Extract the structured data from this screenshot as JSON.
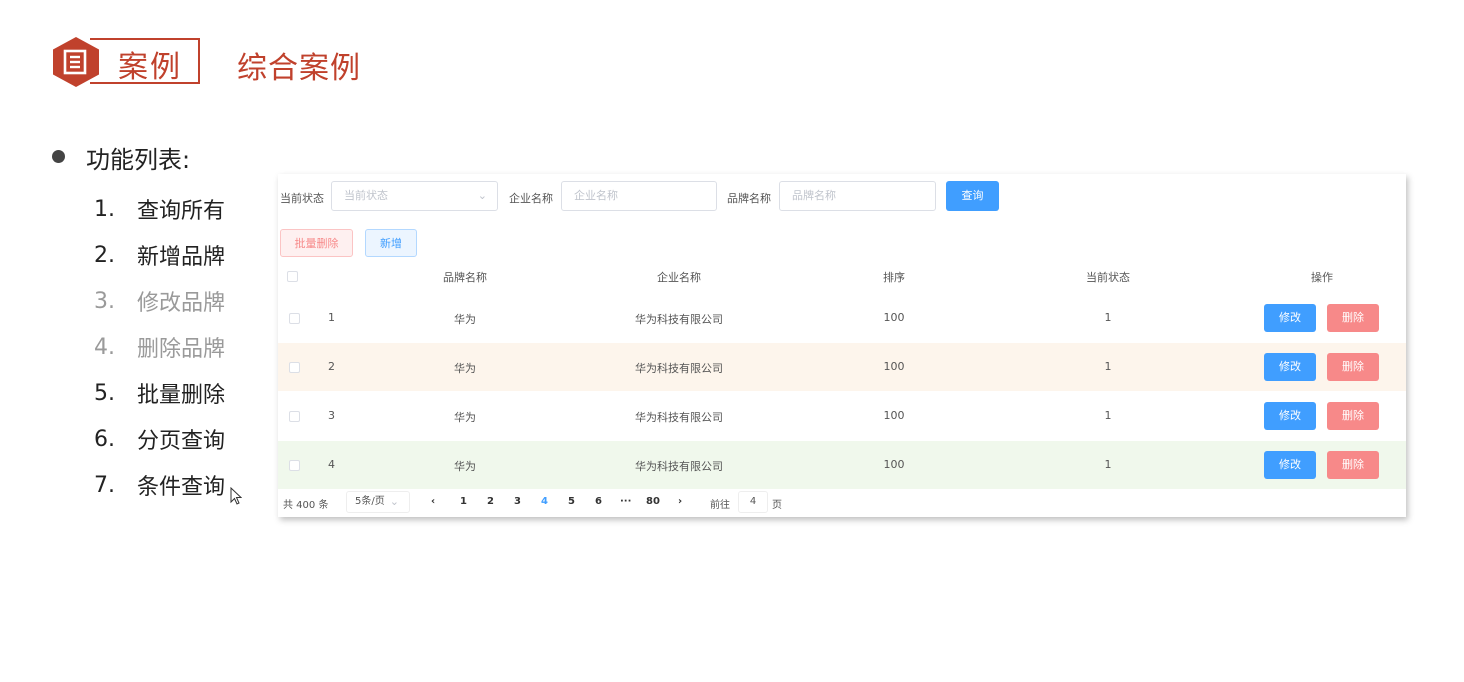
{
  "slide": {
    "badge_label": "案例",
    "title": "综合案例",
    "colors": {
      "accent": "#c0412c"
    }
  },
  "bullets": {
    "heading": "功能列表:",
    "items": [
      {
        "num": "1.",
        "label": "查询所有",
        "state": "active"
      },
      {
        "num": "2.",
        "label": "新增品牌",
        "state": "active"
      },
      {
        "num": "3.",
        "label": "修改品牌",
        "state": "dim"
      },
      {
        "num": "4.",
        "label": "删除品牌",
        "state": "dim"
      },
      {
        "num": "5.",
        "label": "批量删除",
        "state": "active"
      },
      {
        "num": "6.",
        "label": "分页查询",
        "state": "active"
      },
      {
        "num": "7.",
        "label": "条件查询",
        "state": "active"
      }
    ]
  },
  "search_form": {
    "status_label": "当前状态",
    "status_placeholder": "当前状态",
    "company_label": "企业名称",
    "company_placeholder": "企业名称",
    "brand_label": "品牌名称",
    "brand_placeholder": "品牌名称",
    "query_button": "查询"
  },
  "toolbar": {
    "batch_delete": "批量删除",
    "add": "新增"
  },
  "table": {
    "headers": [
      "品牌名称",
      "企业名称",
      "排序",
      "当前状态",
      "操作"
    ],
    "rows": [
      {
        "index": "1",
        "brand": "华为",
        "company": "华为科技有限公司",
        "order": "100",
        "status": "1",
        "bg": "#ffffff"
      },
      {
        "index": "2",
        "brand": "华为",
        "company": "华为科技有限公司",
        "order": "100",
        "status": "1",
        "bg": "#fdf5ec"
      },
      {
        "index": "3",
        "brand": "华为",
        "company": "华为科技有限公司",
        "order": "100",
        "status": "1",
        "bg": "#ffffff"
      },
      {
        "index": "4",
        "brand": "华为",
        "company": "华为科技有限公司",
        "order": "100",
        "status": "1",
        "bg": "#f0f8ec"
      }
    ],
    "edit_label": "修改",
    "delete_label": "删除"
  },
  "pagination": {
    "total": "共 400 条",
    "page_size": "5条/页",
    "prev": "‹",
    "pages": [
      "1",
      "2",
      "3",
      "4",
      "5",
      "6",
      "···",
      "80"
    ],
    "current": "4",
    "next": "›",
    "goto_label": "前往",
    "goto_value": "4",
    "page_suffix": "页"
  }
}
